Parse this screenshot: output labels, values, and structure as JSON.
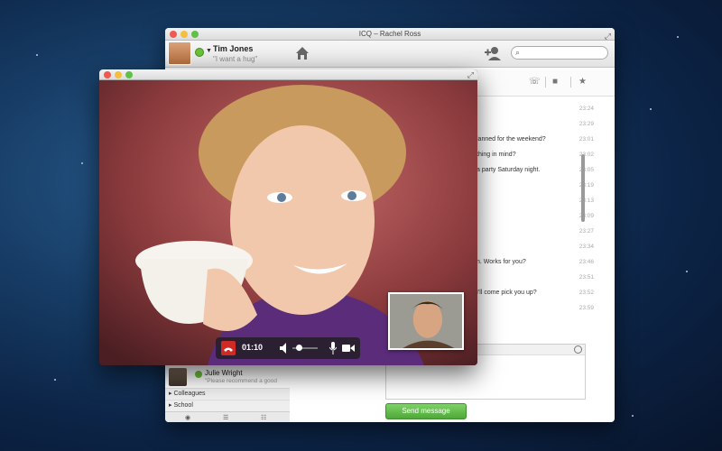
{
  "desktop": {
    "background": "#173d66"
  },
  "chat_window": {
    "title": "ICQ – Rachel Ross",
    "user": {
      "name": "Tim Jones",
      "status": "\"I want a hug\""
    },
    "search": {
      "placeholder": ""
    },
    "messages": [
      {
        "text": "",
        "time": "23:24"
      },
      {
        "text": "",
        "time": "23:29"
      },
      {
        "text": "lanned for the weekend?",
        "time": "23:01"
      },
      {
        "text": "thing in mind?",
        "time": "23:02"
      },
      {
        "text": "a party Saturday night.",
        "time": "23:05"
      },
      {
        "text": "",
        "time": "23:19"
      },
      {
        "text": "",
        "time": "23:13"
      },
      {
        "text": "",
        "time": "23:09"
      },
      {
        "text": "",
        "time": "23:27"
      },
      {
        "text": "",
        "time": "23:34"
      },
      {
        "text": "n. Works for you?",
        "time": "23:46"
      },
      {
        "text": "",
        "time": "23:51"
      },
      {
        "text": "I'll come pick you up?",
        "time": "23:52"
      },
      {
        "text": "",
        "time": "23:59"
      }
    ],
    "send_label": "Send message",
    "contacts": {
      "julie": {
        "name": "Julie Wright",
        "status": "\"Please recommend a good"
      },
      "groups": [
        "Colleagues",
        "School"
      ]
    }
  },
  "video_call": {
    "timer": "01:10",
    "volume_level": 0.2,
    "hangup_color": "#d02a24"
  },
  "icons": [
    "home-icon",
    "add-contact-icon",
    "search-icon",
    "phone-icon",
    "video-icon",
    "star-icon",
    "smiley-icon",
    "hangup-icon",
    "volume-icon",
    "microphone-icon",
    "camera-icon",
    "eye-icon",
    "list-icon"
  ]
}
